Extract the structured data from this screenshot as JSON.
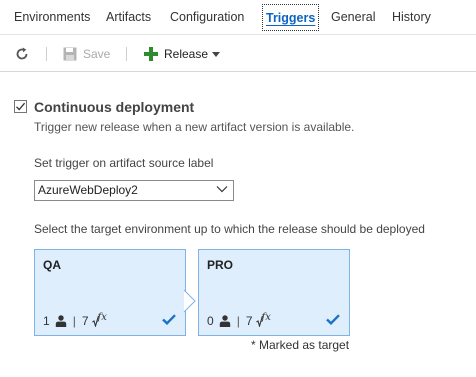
{
  "tabs": [
    {
      "label": "Environments"
    },
    {
      "label": "Artifacts"
    },
    {
      "label": "Configuration"
    },
    {
      "label": "Triggers",
      "active": true
    },
    {
      "label": "General"
    },
    {
      "label": "History"
    }
  ],
  "toolbar": {
    "refresh_icon": "refresh-icon",
    "save_label": "Save",
    "save_icon": "floppy-disk-icon",
    "release_label": "Release",
    "release_icon": "plus-icon"
  },
  "continuous_deployment": {
    "checked": true,
    "title": "Continuous deployment",
    "description": "Trigger new release when a new artifact version is available."
  },
  "artifact_source": {
    "label": "Set trigger on artifact source label",
    "selected": "AzureWebDeploy2"
  },
  "target_environment": {
    "label": "Select the target environment up to which the release should be deployed",
    "environments": [
      {
        "name": "QA",
        "approvers": "1",
        "variables": "7",
        "checked": true
      },
      {
        "name": "PRO",
        "approvers": "0",
        "variables": "7",
        "checked": true
      }
    ],
    "marked_note": "* Marked as target"
  },
  "colors": {
    "accent": "#0c64c0",
    "card_bg": "#dfeefc",
    "card_border": "#7fb2e5",
    "check_blue": "#1a73c9",
    "release_green": "#2e8b2e"
  }
}
